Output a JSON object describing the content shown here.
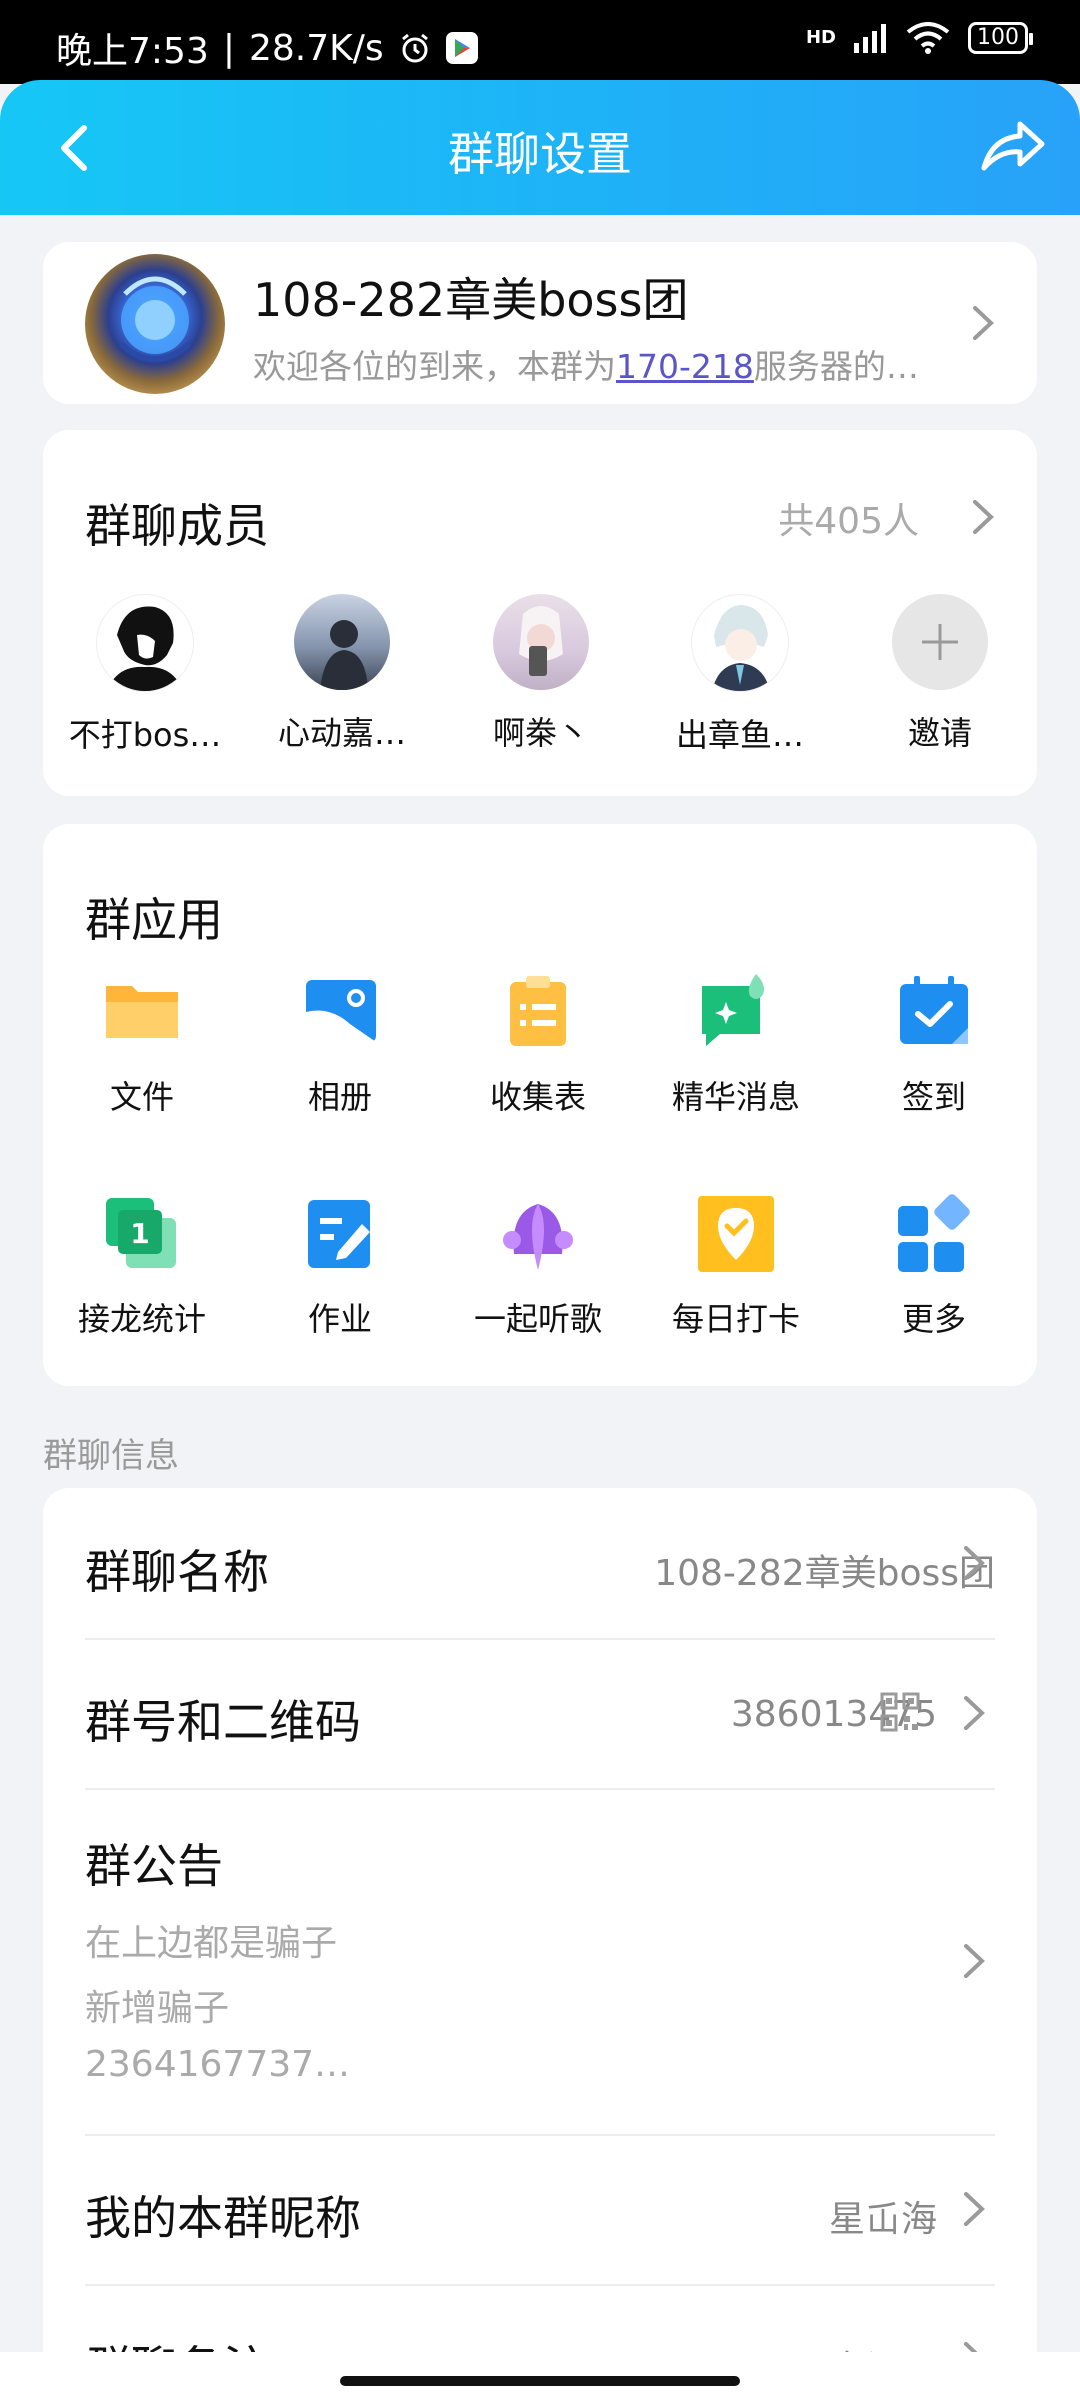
{
  "status_bar": {
    "time": "晚上7:53",
    "net_speed": "28.7K/s",
    "network": "HD",
    "battery": "100"
  },
  "header": {
    "title": "群聊设置"
  },
  "group": {
    "name": "108-282章美boss团",
    "desc_before": "欢迎各位的到来，本群为",
    "desc_link": "170-218",
    "desc_after": "服务器的…"
  },
  "members": {
    "title": "群聊成员",
    "count": "共405人",
    "list": [
      {
        "name": "不打bos…"
      },
      {
        "name": "心动嘉…"
      },
      {
        "name": "啊桊丶"
      },
      {
        "name": "出章鱼…"
      }
    ],
    "invite_label": "邀请"
  },
  "apps": {
    "title": "群应用",
    "items": [
      {
        "label": "文件",
        "icon": "folder-icon"
      },
      {
        "label": "相册",
        "icon": "album-icon"
      },
      {
        "label": "收集表",
        "icon": "clipboard-icon"
      },
      {
        "label": "精华消息",
        "icon": "essence-message-icon"
      },
      {
        "label": "签到",
        "icon": "calendar-check-icon"
      },
      {
        "label": "接龙统计",
        "icon": "relay-count-icon"
      },
      {
        "label": "作业",
        "icon": "homework-icon"
      },
      {
        "label": "一起听歌",
        "icon": "listen-together-icon"
      },
      {
        "label": "每日打卡",
        "icon": "daily-checkin-icon"
      },
      {
        "label": "更多",
        "icon": "more-apps-icon"
      }
    ]
  },
  "info": {
    "section_label": "群聊信息",
    "group_name_label": "群聊名称",
    "group_name_value": "108-282章美boss团",
    "group_id_label": "群号和二维码",
    "group_id_value": "386013475",
    "notice_label": "群公告",
    "notice_lines": [
      "在上边都是骗子",
      "新增骗子",
      "2364167737…"
    ],
    "nickname_label": "我的本群昵称",
    "nickname_value": "星屲海",
    "remark_label": "群聊备注",
    "remark_value": "未设置"
  },
  "colors": {
    "header_gradient_start": "#16c7f6",
    "header_gradient_end": "#28a2f8",
    "link": "#5a55c9",
    "background": "#f2f3f7"
  }
}
